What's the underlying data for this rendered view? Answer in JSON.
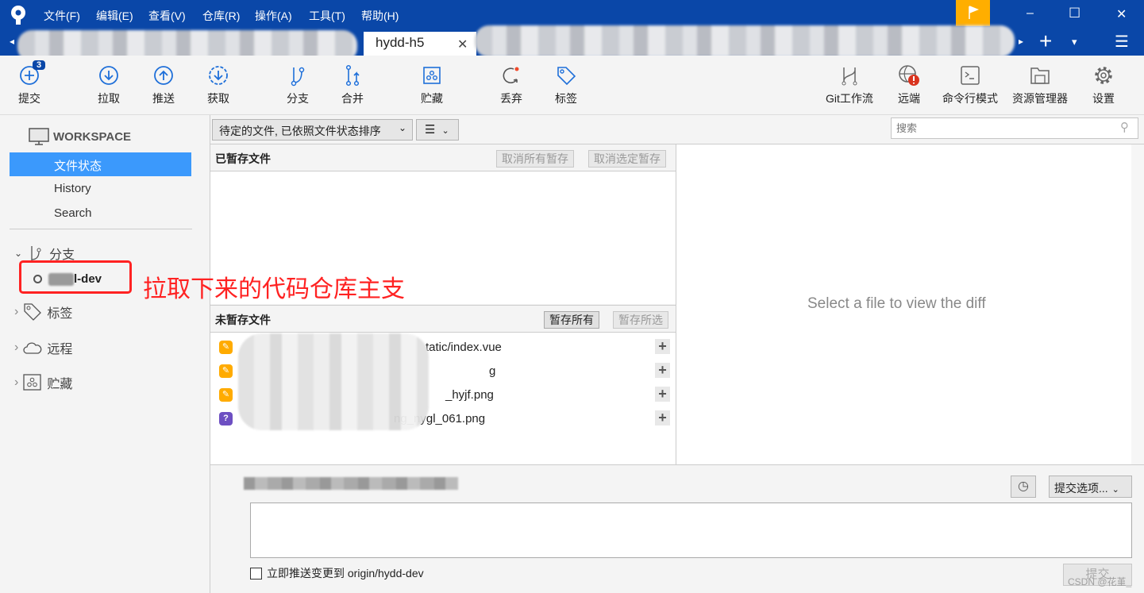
{
  "titlebar": {
    "menus": [
      "文件(F)",
      "编辑(E)",
      "查看(V)",
      "仓库(R)",
      "操作(A)",
      "工具(T)",
      "帮助(H)"
    ],
    "minimize": "–",
    "maximize": "☐",
    "close": "✕",
    "flag_color": "#ffae00"
  },
  "tabs": {
    "active": "hydd-h5",
    "close": "✕",
    "add": "+",
    "dropdown": "▾",
    "menu": "☰",
    "left": "◂",
    "right": "▸"
  },
  "toolbar": {
    "commit": "提交",
    "commit_badge": "3",
    "pull": "拉取",
    "push": "推送",
    "fetch": "获取",
    "branch": "分支",
    "merge": "合并",
    "stash": "贮藏",
    "discard": "丢弃",
    "tag": "标签",
    "gitflow": "Git工作流",
    "remote": "远端",
    "terminal": "命令行模式",
    "explorer": "资源管理器",
    "settings": "设置"
  },
  "sidebar": {
    "workspace": "WORKSPACE",
    "items": [
      "文件状态",
      "History",
      "Search"
    ],
    "branches": "分支",
    "branch_name": "l-dev",
    "tags": "标签",
    "remotes": "远程",
    "stashes": "贮藏"
  },
  "annotation": "拉取下来的代码仓库主支",
  "filter": {
    "sort": "待定的文件, 已依照文件状态排序",
    "view": "☰",
    "search_placeholder": "搜索"
  },
  "staged": {
    "title": "已暂存文件",
    "unstage_all": "取消所有暂存",
    "unstage_selected": "取消选定暂存"
  },
  "unstaged": {
    "title": "未暂存文件",
    "stage_all": "暂存所有",
    "stage_selected": "暂存所选",
    "files": [
      {
        "name": "tatic/index.vue",
        "status": "modified"
      },
      {
        "name": "g",
        "status": "modified"
      },
      {
        "name": "_hyjf.png",
        "status": "modified"
      },
      {
        "name": "ng_nygl_061.png",
        "status": "untracked"
      }
    ]
  },
  "diff": {
    "placeholder": "Select a file to view the diff"
  },
  "commit": {
    "options": "提交选项...",
    "push_label": "立即推送变更到 origin/hydd-dev",
    "submit": "提交",
    "message": ""
  },
  "watermark": "CSDN @花堇_"
}
